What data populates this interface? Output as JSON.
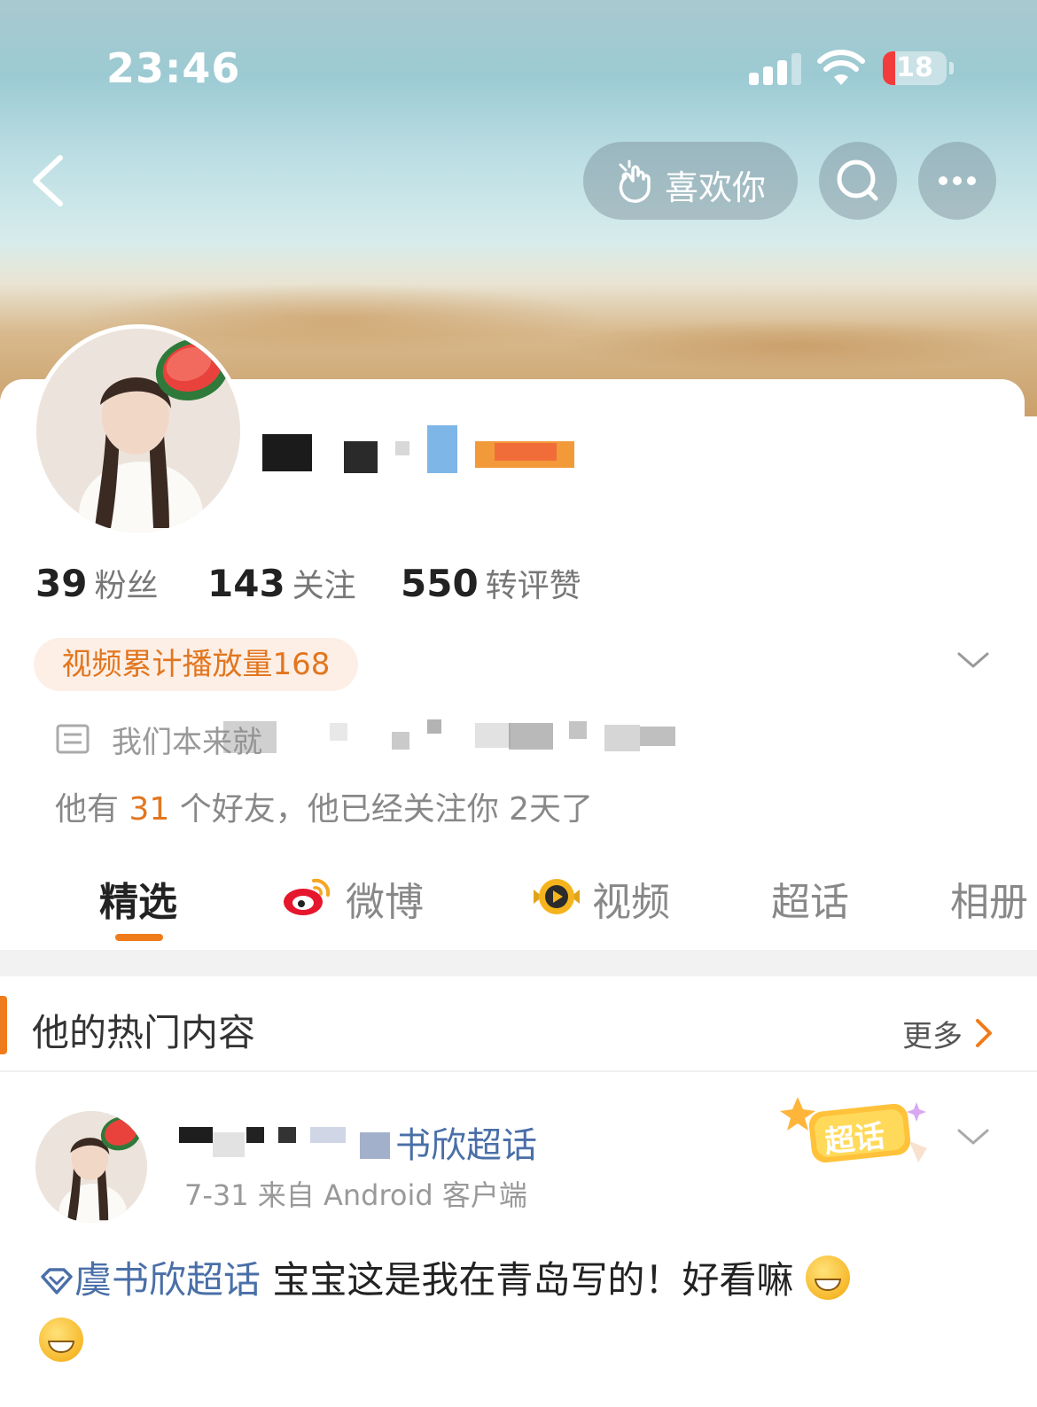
{
  "status_bar": {
    "time": "23:46",
    "battery": "18"
  },
  "header": {
    "like_button_label": "喜欢你"
  },
  "profile": {
    "stats": [
      {
        "num": "39",
        "label": "粉丝"
      },
      {
        "num": "143",
        "label": "关注"
      },
      {
        "num": "550",
        "label": "转评赞"
      }
    ],
    "video_badge": "视频累计播放量168",
    "bio_visible": "我们本来就",
    "friends": {
      "prefix": "他有 ",
      "count": "31",
      "suffix": " 个好友，他已经关注你 2天了"
    }
  },
  "tabs": [
    {
      "label": "精选"
    },
    {
      "label": "微博"
    },
    {
      "label": "视频"
    },
    {
      "label": "超话"
    },
    {
      "label": "相册"
    }
  ],
  "hot_section": {
    "title": "他的热门内容",
    "more": "更多"
  },
  "post": {
    "topic_tail": "书欣超话",
    "meta": "7-31  来自 Android 客户端",
    "badge": "超话",
    "topic_link": "虞书欣超话",
    "text": " 宝宝这是我在青岛写的！好看嘛"
  },
  "colors": {
    "accent": "#f07b1a",
    "link": "#4a6fa8",
    "badge_bg": "#fdefe6"
  }
}
